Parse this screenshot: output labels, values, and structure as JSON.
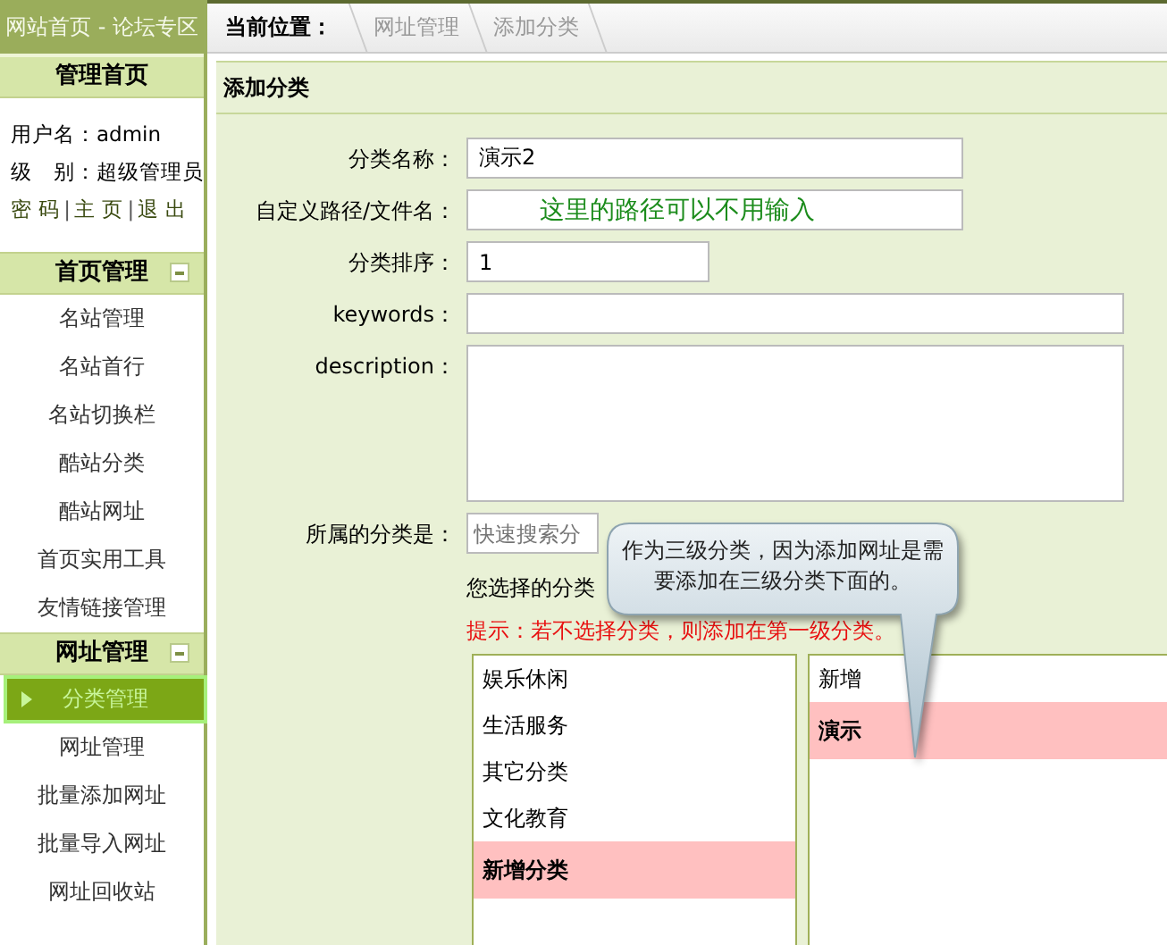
{
  "sidebar": {
    "header": "网站首页 - 论坛专区",
    "home_title": "管理首页",
    "user": {
      "username": "用户名：admin",
      "level": "级　别：超级管理员",
      "links": [
        {
          "label": "密 码"
        },
        {
          "label": "主 页"
        },
        {
          "label": "退 出"
        }
      ],
      "separator": "|"
    },
    "sections": [
      {
        "title": "首页管理",
        "expanded": true,
        "items": [
          {
            "label": "名站管理",
            "selected": false
          },
          {
            "label": "名站首行",
            "selected": false
          },
          {
            "label": "名站切换栏",
            "selected": false
          },
          {
            "label": "酷站分类",
            "selected": false
          },
          {
            "label": "酷站网址",
            "selected": false
          },
          {
            "label": "首页实用工具",
            "selected": false
          },
          {
            "label": "友情链接管理",
            "selected": false
          }
        ]
      },
      {
        "title": "网址管理",
        "expanded": true,
        "items": [
          {
            "label": "分类管理",
            "selected": true
          },
          {
            "label": "网址管理",
            "selected": false
          },
          {
            "label": "批量添加网址",
            "selected": false
          },
          {
            "label": "批量导入网址",
            "selected": false
          },
          {
            "label": "网址回收站",
            "selected": false
          }
        ]
      }
    ]
  },
  "breadcrumb": {
    "label": "当前位置：",
    "items": [
      "网址管理",
      "添加分类"
    ]
  },
  "panel": {
    "title": "添加分类",
    "fields": [
      {
        "label": "分类名称：",
        "value": "演示2",
        "kind": "short"
      },
      {
        "label": "自定义路径/文件名：",
        "value": "这里的路径可以不用输入",
        "kind": "short"
      },
      {
        "label": "分类排序：",
        "value": "1",
        "kind": "tiny"
      },
      {
        "label": "keywords：",
        "kind": "long"
      },
      {
        "label": "description：",
        "kind": "area"
      }
    ],
    "category": {
      "label": "所属的分类是：",
      "placeholder": "快速搜索分",
      "selection": "您选择的分类",
      "hint": "提示：若不选择分类，则添加在第一级分类。",
      "lists": [
        [
          {
            "label": "娱乐休闲",
            "selected": false
          },
          {
            "label": "生活服务",
            "selected": false
          },
          {
            "label": "其它分类",
            "selected": false
          },
          {
            "label": "文化教育",
            "selected": false
          },
          {
            "label": "新增分类",
            "selected": true
          }
        ],
        [
          {
            "label": "新增",
            "selected": false
          },
          {
            "label": "演示",
            "selected": true
          }
        ]
      ]
    }
  },
  "callout": "作为三级分类，因为添加网址是需要添加在三级分类下面的。"
}
